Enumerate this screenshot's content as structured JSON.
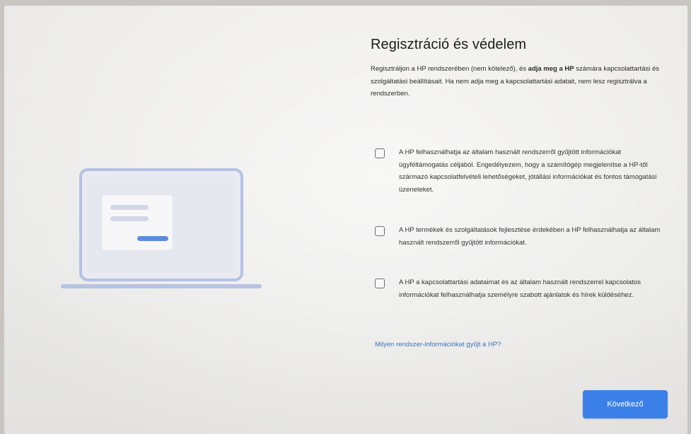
{
  "page": {
    "title": "Regisztráció és védelem",
    "intro_part1": "Regisztráljon a HP rendszerében (nem kötelező), és ",
    "intro_bold": "adja meg a HP",
    "intro_part2": " számára kapcsolattartási és szolgáltatási beállításait. Ha nem adja meg a kapcsolattartási adatait, nem lesz regisztrálva a rendszerben."
  },
  "options": [
    {
      "label": "A HP felhasználhatja az általam használt rendszerről gyűjtött információkat ügyféltámogatás céljából. Engedélyezem, hogy a számítógép megjelenítse a HP-től származó kapcsolatfelvételi lehetőségeket, jótállási információkat és fontos támogatási üzeneteket.",
      "checked": false
    },
    {
      "label": "A HP termékek és szolgáltatások fejlesztése érdekében a HP felhasználhatja az általam használt rendszerről gyűjtött információkat.",
      "checked": false
    },
    {
      "label": "A HP a kapcsolattartási adataimat és az általam használt rendszerrel kapcsolatos információkat felhasználhatja személyre szabott ajánlatok és hírek küldéséhez.",
      "checked": false
    }
  ],
  "info_link": "Milyen rendszer-információkat gyűjt a HP?",
  "next_button": "Következő",
  "colors": {
    "accent": "#3b80e8",
    "link": "#3f71b5",
    "illustration": "#b6c1e3"
  },
  "icons": {
    "illustration": "laptop-illustration-icon",
    "checkbox": "checkbox-unchecked-icon"
  }
}
